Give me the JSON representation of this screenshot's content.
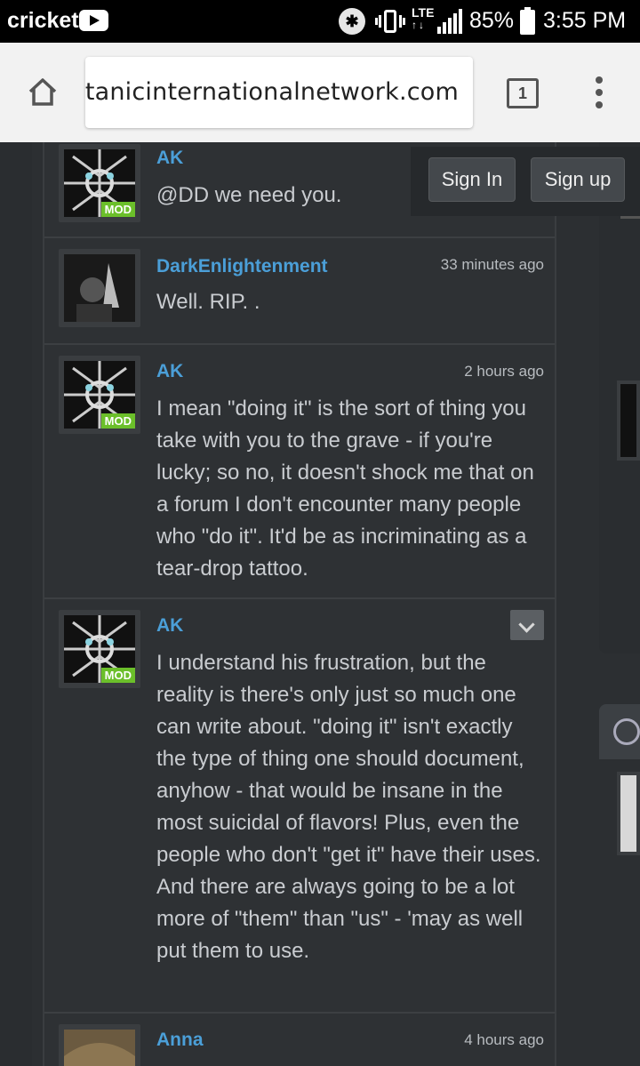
{
  "status_bar": {
    "carrier": "cricket",
    "network": "LTE",
    "battery": "85%",
    "time": "3:55 PM"
  },
  "browser": {
    "url": "satanicinternationalnetwork.com",
    "tab_count": "1"
  },
  "auth": {
    "sign_in": "Sign In",
    "sign_up": "Sign up"
  },
  "posts": [
    {
      "user": "AK",
      "badge": "MOD",
      "time": "",
      "text": "@DD we need you."
    },
    {
      "user": "DarkEnlightenment",
      "badge": "",
      "time": "33 minutes ago",
      "text": "Well. RIP. ."
    },
    {
      "user": "AK",
      "badge": "MOD",
      "time": "2 hours ago",
      "text": "I mean \"doing it\" is the sort of thing you take with you to the grave - if you're lucky; so no, it doesn't shock me that on a forum I don't encounter many people who \"do it\". It'd be as incriminating as a tear-drop tattoo."
    },
    {
      "user": "AK",
      "badge": "MOD",
      "time": "",
      "text": "I understand his frustration, but the reality is there's only just so much one can write about. \"doing it\" isn't exactly the type of thing one should document, anyhow - that would be insane in the most suicidal of flavors! Plus, even the people who don't \"get it\" have their uses. And there are always going to be a lot more of \"them\" than \"us\" - 'may as well put them to use."
    },
    {
      "user": "Anna",
      "badge": "",
      "time": "4 hours ago",
      "text": ""
    }
  ],
  "colors": {
    "username": "#4b9fd8",
    "mod_badge": "#6bbf2a",
    "background": "#2c2f32"
  }
}
